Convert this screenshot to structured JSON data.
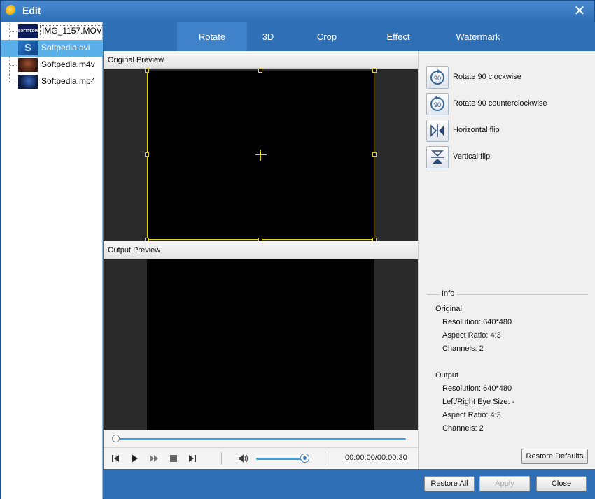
{
  "window": {
    "title": "Edit"
  },
  "files": [
    {
      "name": "IMG_1157.MOV",
      "thumb_color": "#0a1a5a",
      "thumb_text": "SOFTPEDIA"
    },
    {
      "name": "Softpedia.avi",
      "thumb_color": "#1c5fa8",
      "thumb_text": "S"
    },
    {
      "name": "Softpedia.m4v",
      "thumb_color": "#5a2a1a",
      "thumb_text": ""
    },
    {
      "name": "Softpedia.mp4",
      "thumb_color": "#0b1c40",
      "thumb_text": ""
    }
  ],
  "tabs": [
    "Rotate",
    "3D",
    "Crop",
    "Effect",
    "Watermark"
  ],
  "active_tab": "Rotate",
  "preview": {
    "original_label": "Original Preview",
    "output_label": "Output Preview",
    "timecode": "00:00:00/00:00:30",
    "seek_progress": 0.0,
    "volume_level": 0.9
  },
  "actions": [
    {
      "label": "Rotate 90 clockwise",
      "icon": "rotate-clockwise-icon",
      "glyph": "90"
    },
    {
      "label": "Rotate 90 counterclockwise",
      "icon": "rotate-counterclockwise-icon",
      "glyph": "90"
    },
    {
      "label": "Horizontal flip",
      "icon": "horizontal-flip-icon",
      "glyph": "▷|◁"
    },
    {
      "label": "Vertical flip",
      "icon": "vertical-flip-icon",
      "glyph": "▽ △"
    }
  ],
  "info": {
    "title": "Info",
    "original_heading": "Original",
    "original_lines": [
      "Resolution: 640*480",
      "Aspect Ratio: 4:3",
      "Channels: 2"
    ],
    "output_heading": "Output",
    "output_lines": [
      "Resolution: 640*480",
      "Left/Right Eye Size: -",
      "Aspect Ratio: 4:3",
      "Channels: 2"
    ]
  },
  "buttons": {
    "restore_defaults": "Restore Defaults",
    "restore_all": "Restore All",
    "apply": "Apply",
    "close": "Close"
  },
  "colors": {
    "accent": "#2f6fb5",
    "selection": "#5bb0ea",
    "crop": "#e0d020"
  }
}
